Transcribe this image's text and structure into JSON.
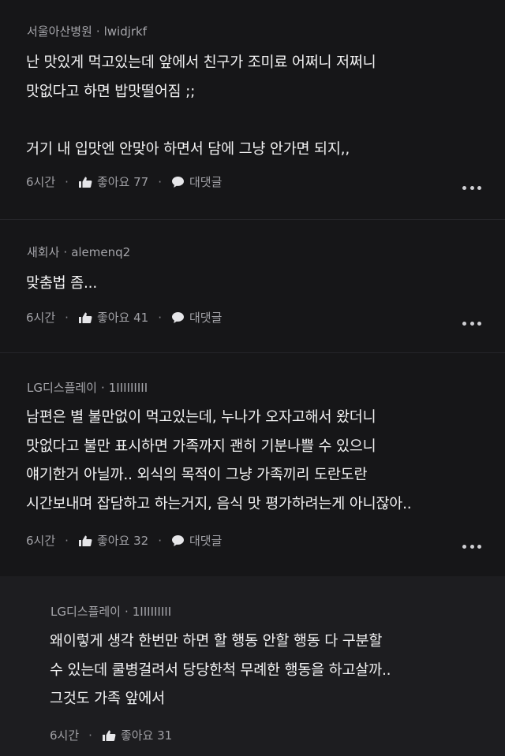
{
  "comments": [
    {
      "author": "서울아산병원",
      "handle": "lwidjrkf",
      "text": "난 맛있게 먹고있는데 앞에서 친구가 조미료 어쩌니 저쩌니\n맛없다고 하면 밥맛떨어짐 ;;\n\n거기 내 입맛엔 안맞아 하면서 담에 그냥 안가면 되지,,",
      "time": "6시간",
      "like_label": "좋아요",
      "likes": "77",
      "reply_label": "대댓글"
    },
    {
      "author": "새회사",
      "handle": "alemenq2",
      "text": "맞춤법 좀...",
      "time": "6시간",
      "like_label": "좋아요",
      "likes": "41",
      "reply_label": "대댓글"
    },
    {
      "author": "LG디스플레이",
      "handle": "1IIIIIIIII",
      "text": "남편은 별 불만없이 먹고있는데, 누나가 오자고해서 왔더니\n맛없다고 불만 표시하면 가족까지 괜히 기분나쁠 수 있으니\n얘기한거 아닐까.. 외식의 목적이 그냥 가족끼리 도란도란\n시간보내며 잡담하고 하는거지, 음식 맛 평가하려는게 아니잖아..",
      "time": "6시간",
      "like_label": "좋아요",
      "likes": "32",
      "reply_label": "대댓글"
    },
    {
      "author": "LG디스플레이",
      "handle": "1IIIIIIIII",
      "text": "왜이렇게 생각 한번만 하면 할 행동 안할 행동 다 구분할\n수 있는데 쿨병걸려서 당당한척 무례한 행동을 하고살까..\n그것도 가족 앞에서",
      "time": "6시간",
      "like_label": "좋아요",
      "likes": "31"
    }
  ],
  "colors": {
    "background": "#161618",
    "reply_background": "#1d1d20",
    "text": "#f2f2f3",
    "meta": "#a5a5aa"
  },
  "icons": {
    "like": "thumbs-up-icon",
    "reply": "speech-bubble-icon",
    "more": "more-dots-icon"
  }
}
